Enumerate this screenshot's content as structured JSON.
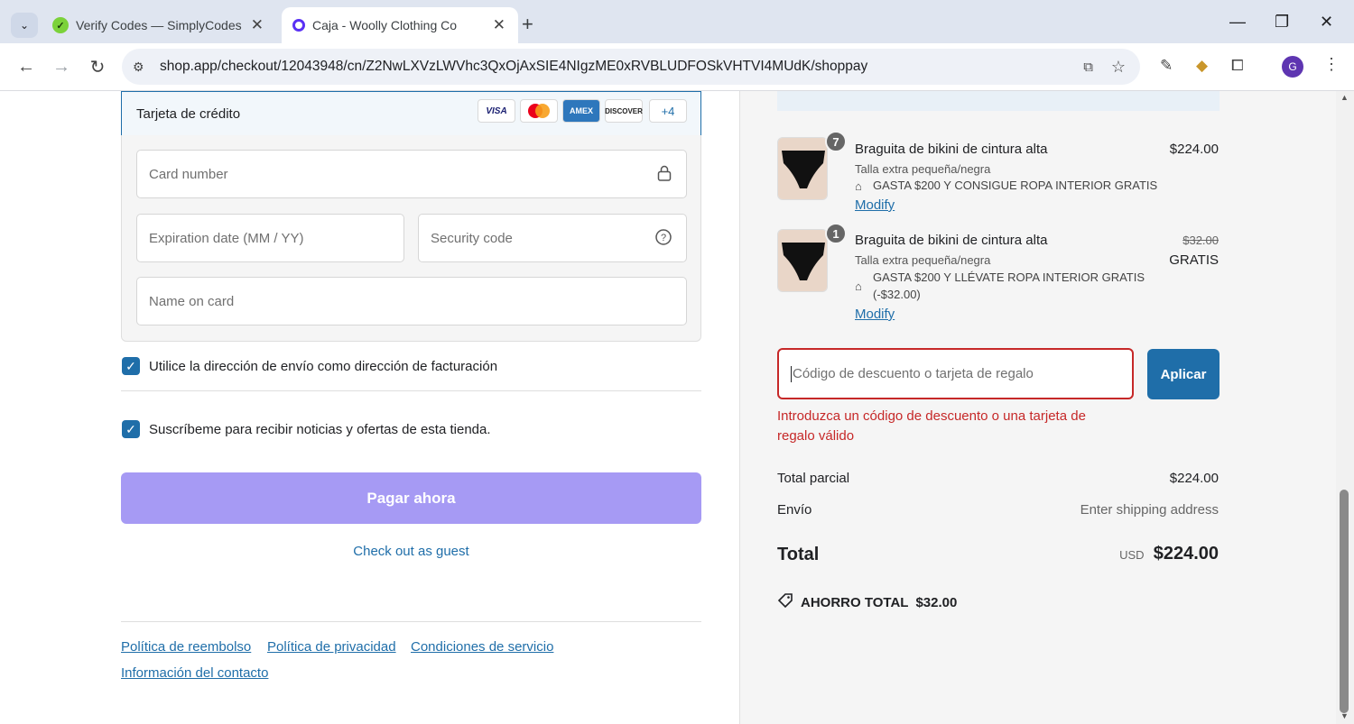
{
  "browser": {
    "tabs": [
      {
        "title": "Verify Codes — SimplyCodes",
        "favicon": "simplycodes-icon"
      },
      {
        "title": "Caja - Woolly Clothing Co",
        "favicon": "shop-icon"
      }
    ],
    "url": "shop.app/checkout/12043948/cn/Z2NwLXVzLWVhc3QxOjAxSIE4NIgzME0xRVBLUDFOSkVHTVI4MUdK/shoppay",
    "profile_initial": "G"
  },
  "payment": {
    "method_label": "Tarjeta de crédito",
    "brands": [
      "VISA",
      "MC",
      "AMEX",
      "DISCOVER",
      "+4"
    ],
    "card_number_placeholder": "Card number",
    "expiration_placeholder": "Expiration date (MM / YY)",
    "security_placeholder": "Security code",
    "name_placeholder": "Name on card"
  },
  "options": {
    "billing_same": "Utilice la dirección de envío como dirección de facturación",
    "subscribe": "Suscríbeme para recibir noticias y ofertas de esta tienda."
  },
  "actions": {
    "pay_now": "Pagar ahora",
    "guest": "Check out as guest"
  },
  "footer_links": [
    "Política de reembolso",
    "Política de privacidad",
    "Condiciones de servicio",
    "Información del contacto"
  ],
  "cart": {
    "items": [
      {
        "qty": "7",
        "name": "Braguita de bikini de cintura alta",
        "variant": "Talla extra pequeña/negra",
        "discount": "GASTA $200 Y CONSIGUE ROPA INTERIOR GRATIS",
        "modify": "Modify",
        "price": "$224.00"
      },
      {
        "qty": "1",
        "name": "Braguita de bikini de cintura alta",
        "variant": "Talla extra pequeña/negra",
        "discount": "GASTA $200 Y LLÉVATE ROPA INTERIOR GRATIS",
        "discount_amount": "(-$32.00)",
        "modify": "Modify",
        "original_price": "$32.00",
        "price": "GRATIS"
      }
    ]
  },
  "discount": {
    "placeholder": "Código de descuento o tarjeta de regalo",
    "apply": "Aplicar",
    "error": "Introduzca un código de descuento o una tarjeta de regalo válido"
  },
  "summary": {
    "subtotal_label": "Total parcial",
    "subtotal_value": "$224.00",
    "shipping_label": "Envío",
    "shipping_value": "Enter shipping address",
    "total_label": "Total",
    "total_currency": "USD",
    "total_value": "$224.00",
    "savings_label": "AHORRO TOTAL",
    "savings_value": "$32.00"
  },
  "colors": {
    "accent": "#1f6ea9",
    "pay_button": "#a69af4",
    "error": "#c62828"
  }
}
